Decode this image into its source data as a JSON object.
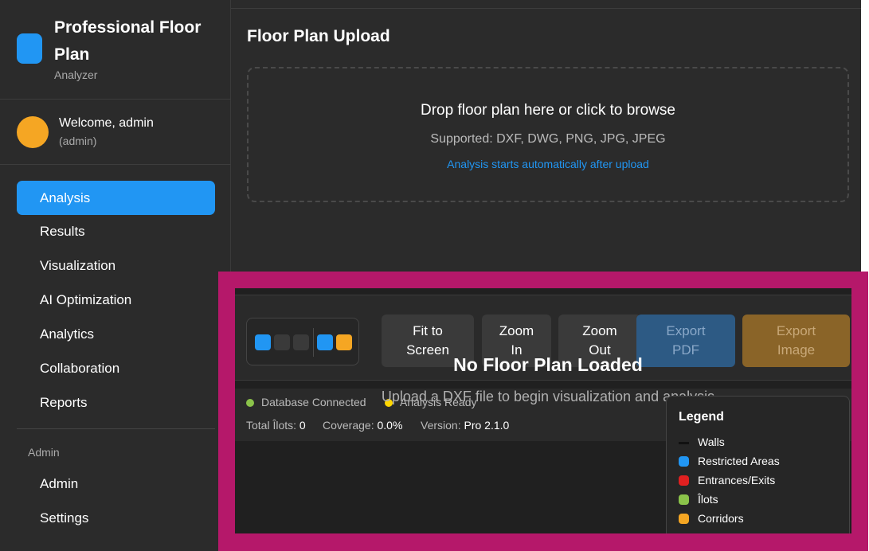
{
  "app": {
    "title": "Professional Floor Plan",
    "subtitle": "Analyzer",
    "accent_color": "#2196f3"
  },
  "user": {
    "welcome": "Welcome, admin",
    "role": "(admin)",
    "avatar_color": "#f5a623"
  },
  "sidebar": {
    "items": [
      {
        "label": "Analysis",
        "active": true
      },
      {
        "label": "Results",
        "active": false
      },
      {
        "label": "Visualization",
        "active": false
      },
      {
        "label": "AI Optimization",
        "active": false
      },
      {
        "label": "Analytics",
        "active": false
      },
      {
        "label": "Collaboration",
        "active": false
      },
      {
        "label": "Reports",
        "active": false
      }
    ],
    "admin_heading": "Admin",
    "admin_items": [
      {
        "label": "Admin"
      },
      {
        "label": "Settings"
      }
    ]
  },
  "upload": {
    "title": "Floor Plan Upload",
    "drop_text": "Drop floor plan here or click to browse",
    "supported": "Supported: DXF, DWG, PNG, JPG, JPEG",
    "note": "Analysis starts automatically after upload"
  },
  "viz": {
    "swatches": [
      "#2196f3",
      "#3a3a3a",
      "#3a3a3a",
      "#2196f3",
      "#f5a623"
    ],
    "buttons": {
      "fit": [
        "Fit to",
        "Screen"
      ],
      "zoom_in": [
        "Zoom",
        "In"
      ],
      "zoom_out": [
        "Zoom",
        "Out"
      ],
      "export_pdf": [
        "Export",
        "PDF"
      ],
      "export_image": [
        "Export",
        "Image"
      ]
    },
    "empty_title": "No Floor Plan Loaded",
    "empty_sub": "Upload a DXF file to begin visualization and analysis"
  },
  "status": {
    "db": "Database Connected",
    "db_color": "#8bc34a",
    "analysis": "Analysis Ready",
    "analysis_color": "#ffd600",
    "total_ilots_label": "Total Îlots:",
    "total_ilots_value": "0",
    "coverage_label": "Coverage:",
    "coverage_value": "0.0%",
    "version_label": "Version:",
    "version_value": "Pro 2.1.0"
  },
  "legend": {
    "title": "Legend",
    "items": [
      {
        "label": "Walls",
        "color": "#111111",
        "kind": "line"
      },
      {
        "label": "Restricted Areas",
        "color": "#2196f3",
        "kind": "box"
      },
      {
        "label": "Entrances/Exits",
        "color": "#e02020",
        "kind": "box"
      },
      {
        "label": "Îlots",
        "color": "#8bc34a",
        "kind": "box"
      },
      {
        "label": "Corridors",
        "color": "#f5a623",
        "kind": "box"
      }
    ]
  }
}
